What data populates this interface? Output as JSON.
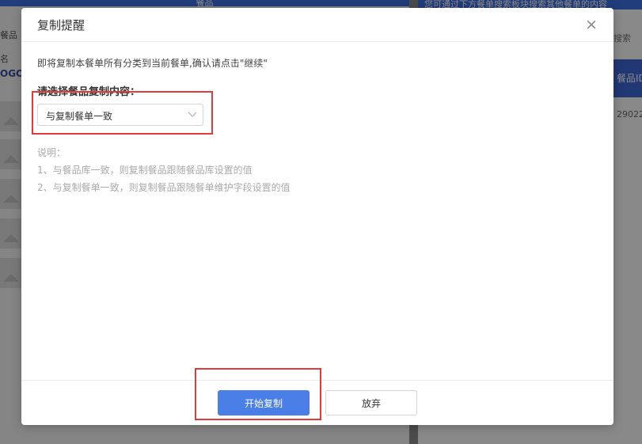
{
  "background": {
    "left_header": "餐品",
    "left_column_header": "餐品名",
    "logo_text": "OGO",
    "right_banner": "您可通过下方餐单搜索板块搜索其他餐单的内容",
    "search_label": "搜索",
    "table_header": "餐品ID",
    "table_cell": "29022"
  },
  "dialog": {
    "title": "复制提醒",
    "close_glyph": "×",
    "confirm_text": "即将复制本餐单所有分类到当前餐单,确认请点击\"继续\"",
    "select_label": "请选择餐品复制内容：",
    "select_value": "与复制餐单一致",
    "description_title": "说明：",
    "description_lines": [
      "1、与餐品库一致，则复制餐品跟随餐品库设置的值",
      "2、与复制餐单一致，则复制餐品跟随餐单维护字段设置的值"
    ],
    "primary_button": "开始复制",
    "secondary_button": "放弃"
  },
  "colors": {
    "primary": "#4a7fe8",
    "highlight": "#e23b3b",
    "header_blue": "#3d6fe0"
  }
}
